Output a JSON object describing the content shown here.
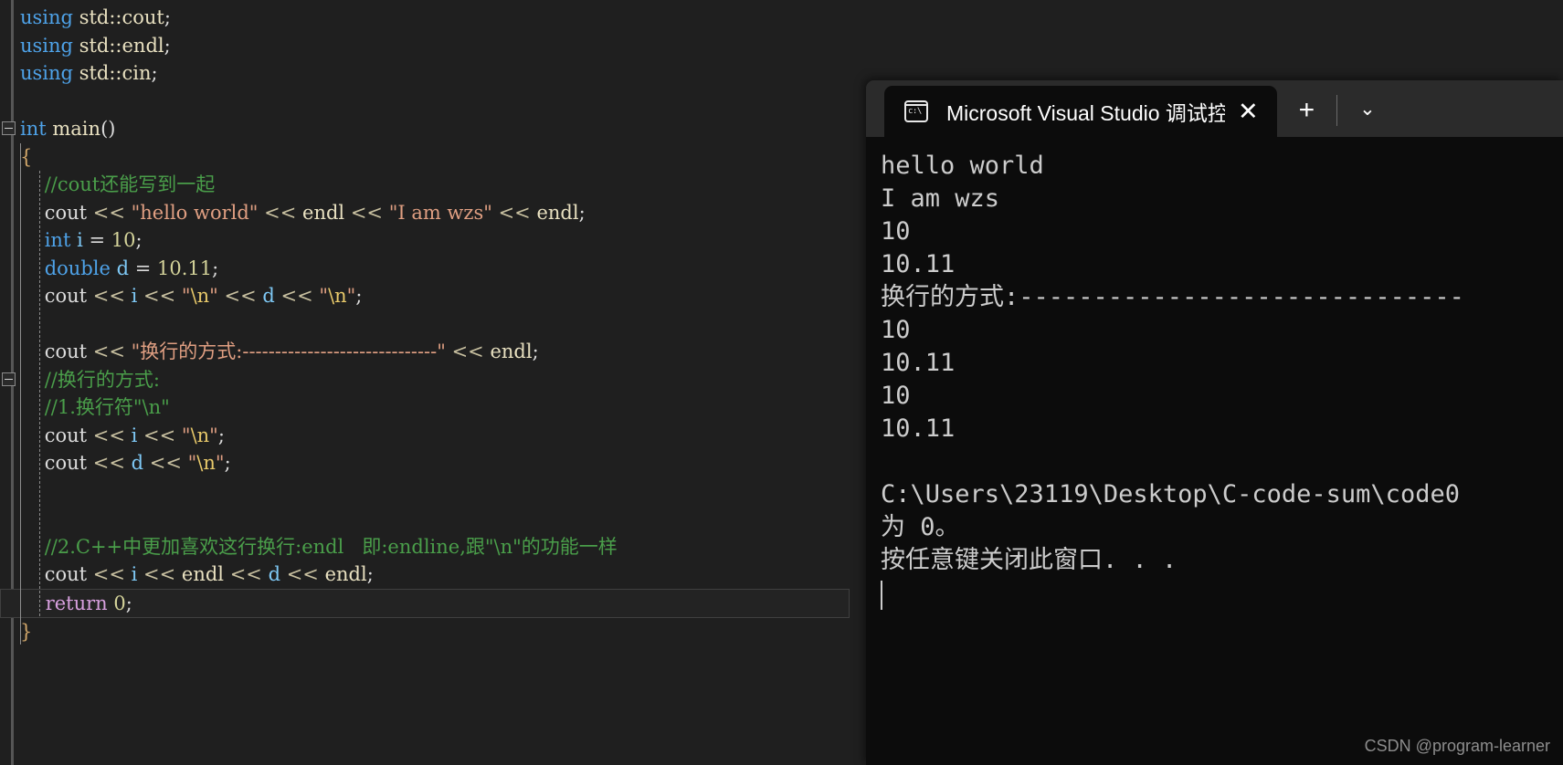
{
  "editor": {
    "language": "cpp",
    "lines": [
      {
        "type": "code",
        "tokens": [
          {
            "t": "using",
            "c": "kw"
          },
          {
            "t": " ",
            "c": "pln"
          },
          {
            "t": "std::cout",
            "c": "id"
          },
          {
            "t": ";",
            "c": "pln"
          }
        ]
      },
      {
        "type": "code",
        "tokens": [
          {
            "t": "using",
            "c": "kw"
          },
          {
            "t": " ",
            "c": "pln"
          },
          {
            "t": "std::endl",
            "c": "id"
          },
          {
            "t": ";",
            "c": "pln"
          }
        ]
      },
      {
        "type": "code",
        "tokens": [
          {
            "t": "using",
            "c": "kw"
          },
          {
            "t": " ",
            "c": "pln"
          },
          {
            "t": "std::cin",
            "c": "id"
          },
          {
            "t": ";",
            "c": "pln"
          }
        ]
      },
      {
        "type": "blank",
        "tokens": []
      },
      {
        "type": "fold",
        "tokens": [
          {
            "t": "int",
            "c": "kw"
          },
          {
            "t": " ",
            "c": "pln"
          },
          {
            "t": "main",
            "c": "id"
          },
          {
            "t": "()",
            "c": "pln"
          }
        ]
      },
      {
        "type": "code",
        "tokens": [
          {
            "t": "{",
            "c": "brc"
          }
        ]
      },
      {
        "type": "code",
        "tokens": [
          {
            "t": "    //cout还能写到一起",
            "c": "cmt"
          }
        ]
      },
      {
        "type": "code",
        "tokens": [
          {
            "t": "    cout",
            "c": "pln"
          },
          {
            "t": " << ",
            "c": "op"
          },
          {
            "t": "\"hello world\"",
            "c": "str"
          },
          {
            "t": " << ",
            "c": "op"
          },
          {
            "t": "endl",
            "c": "id"
          },
          {
            "t": " << ",
            "c": "op"
          },
          {
            "t": "\"I am wzs\"",
            "c": "str"
          },
          {
            "t": " << ",
            "c": "op"
          },
          {
            "t": "endl",
            "c": "id"
          },
          {
            "t": ";",
            "c": "pln"
          }
        ]
      },
      {
        "type": "code",
        "tokens": [
          {
            "t": "    ",
            "c": "pln"
          },
          {
            "t": "int",
            "c": "kw"
          },
          {
            "t": " ",
            "c": "pln"
          },
          {
            "t": "i",
            "c": "var"
          },
          {
            "t": " = ",
            "c": "pln"
          },
          {
            "t": "10",
            "c": "num"
          },
          {
            "t": ";",
            "c": "pln"
          }
        ]
      },
      {
        "type": "code",
        "tokens": [
          {
            "t": "    ",
            "c": "pln"
          },
          {
            "t": "double",
            "c": "kw"
          },
          {
            "t": " ",
            "c": "pln"
          },
          {
            "t": "d",
            "c": "var"
          },
          {
            "t": " = ",
            "c": "pln"
          },
          {
            "t": "10.11",
            "c": "num"
          },
          {
            "t": ";",
            "c": "pln"
          }
        ]
      },
      {
        "type": "code",
        "tokens": [
          {
            "t": "    cout",
            "c": "pln"
          },
          {
            "t": " << ",
            "c": "op"
          },
          {
            "t": "i",
            "c": "var"
          },
          {
            "t": " << ",
            "c": "op"
          },
          {
            "t": "\"",
            "c": "str"
          },
          {
            "t": "\\n",
            "c": "esc"
          },
          {
            "t": "\"",
            "c": "str"
          },
          {
            "t": " << ",
            "c": "op"
          },
          {
            "t": "d",
            "c": "var"
          },
          {
            "t": " << ",
            "c": "op"
          },
          {
            "t": "\"",
            "c": "str"
          },
          {
            "t": "\\n",
            "c": "esc"
          },
          {
            "t": "\"",
            "c": "str"
          },
          {
            "t": ";",
            "c": "pln"
          }
        ]
      },
      {
        "type": "blank",
        "tokens": []
      },
      {
        "type": "code",
        "tokens": [
          {
            "t": "    cout",
            "c": "pln"
          },
          {
            "t": " << ",
            "c": "op"
          },
          {
            "t": "\"换行的方式:------------------------------\"",
            "c": "str"
          },
          {
            "t": " << ",
            "c": "op"
          },
          {
            "t": "endl",
            "c": "id"
          },
          {
            "t": ";",
            "c": "pln"
          }
        ]
      },
      {
        "type": "fold2",
        "tokens": [
          {
            "t": "    //换行的方式:",
            "c": "cmt"
          }
        ]
      },
      {
        "type": "code",
        "tokens": [
          {
            "t": "    //1.换行符\"",
            "c": "cmt"
          },
          {
            "t": "\\n",
            "c": "cmt"
          },
          {
            "t": "\"",
            "c": "cmt"
          }
        ]
      },
      {
        "type": "code",
        "tokens": [
          {
            "t": "    cout",
            "c": "pln"
          },
          {
            "t": " << ",
            "c": "op"
          },
          {
            "t": "i",
            "c": "var"
          },
          {
            "t": " << ",
            "c": "op"
          },
          {
            "t": "\"",
            "c": "str"
          },
          {
            "t": "\\n",
            "c": "esc"
          },
          {
            "t": "\"",
            "c": "str"
          },
          {
            "t": ";",
            "c": "pln"
          }
        ]
      },
      {
        "type": "code",
        "tokens": [
          {
            "t": "    cout",
            "c": "pln"
          },
          {
            "t": " << ",
            "c": "op"
          },
          {
            "t": "d",
            "c": "var"
          },
          {
            "t": " << ",
            "c": "op"
          },
          {
            "t": "\"",
            "c": "str"
          },
          {
            "t": "\\n",
            "c": "esc"
          },
          {
            "t": "\"",
            "c": "str"
          },
          {
            "t": ";",
            "c": "pln"
          }
        ]
      },
      {
        "type": "blank",
        "tokens": []
      },
      {
        "type": "blank",
        "tokens": []
      },
      {
        "type": "code",
        "tokens": [
          {
            "t": "    //2.C++中更加喜欢这行换行:endl   即:endline,跟\"\\n\"的功能一样",
            "c": "cmt"
          }
        ]
      },
      {
        "type": "code",
        "tokens": [
          {
            "t": "    cout",
            "c": "pln"
          },
          {
            "t": " << ",
            "c": "op"
          },
          {
            "t": "i",
            "c": "var"
          },
          {
            "t": " << ",
            "c": "op"
          },
          {
            "t": "endl",
            "c": "id"
          },
          {
            "t": " << ",
            "c": "op"
          },
          {
            "t": "d",
            "c": "var"
          },
          {
            "t": " << ",
            "c": "op"
          },
          {
            "t": "endl",
            "c": "id"
          },
          {
            "t": ";",
            "c": "pln"
          }
        ]
      },
      {
        "type": "current",
        "tokens": [
          {
            "t": "    ",
            "c": "pln"
          },
          {
            "t": "return",
            "c": "kw2"
          },
          {
            "t": " ",
            "c": "pln"
          },
          {
            "t": "0",
            "c": "num"
          },
          {
            "t": ";",
            "c": "pln"
          }
        ]
      },
      {
        "type": "code",
        "tokens": [
          {
            "t": "}",
            "c": "brc"
          }
        ]
      }
    ]
  },
  "terminal": {
    "tab": {
      "title": "Microsoft Visual Studio 调试控制台",
      "icon": "console-icon",
      "icon_text": "c:\\",
      "close_label": "✕",
      "new_tab_label": "+",
      "dropdown_label": "⌄"
    },
    "output_lines": [
      "hello world",
      "I am wzs",
      "10",
      "10.11",
      "换行的方式:------------------------------",
      "10",
      "10.11",
      "10",
      "10.11",
      "",
      "C:\\Users\\23119\\Desktop\\C-code-sum\\code0",
      "为 0。",
      "按任意键关闭此窗口. . ."
    ]
  },
  "watermark": {
    "text": "CSDN @program-learner"
  },
  "colors": {
    "editor_bg": "#1f1f1f",
    "terminal_bg": "#0c0c0c",
    "titlebar_bg": "#2b2b2b",
    "comment": "#4a9e4a",
    "keyword": "#4ea2e8",
    "string": "#e09f82",
    "escape": "#e8c96a",
    "return_keyword": "#d8a0df",
    "terminal_text": "#cccccc"
  }
}
